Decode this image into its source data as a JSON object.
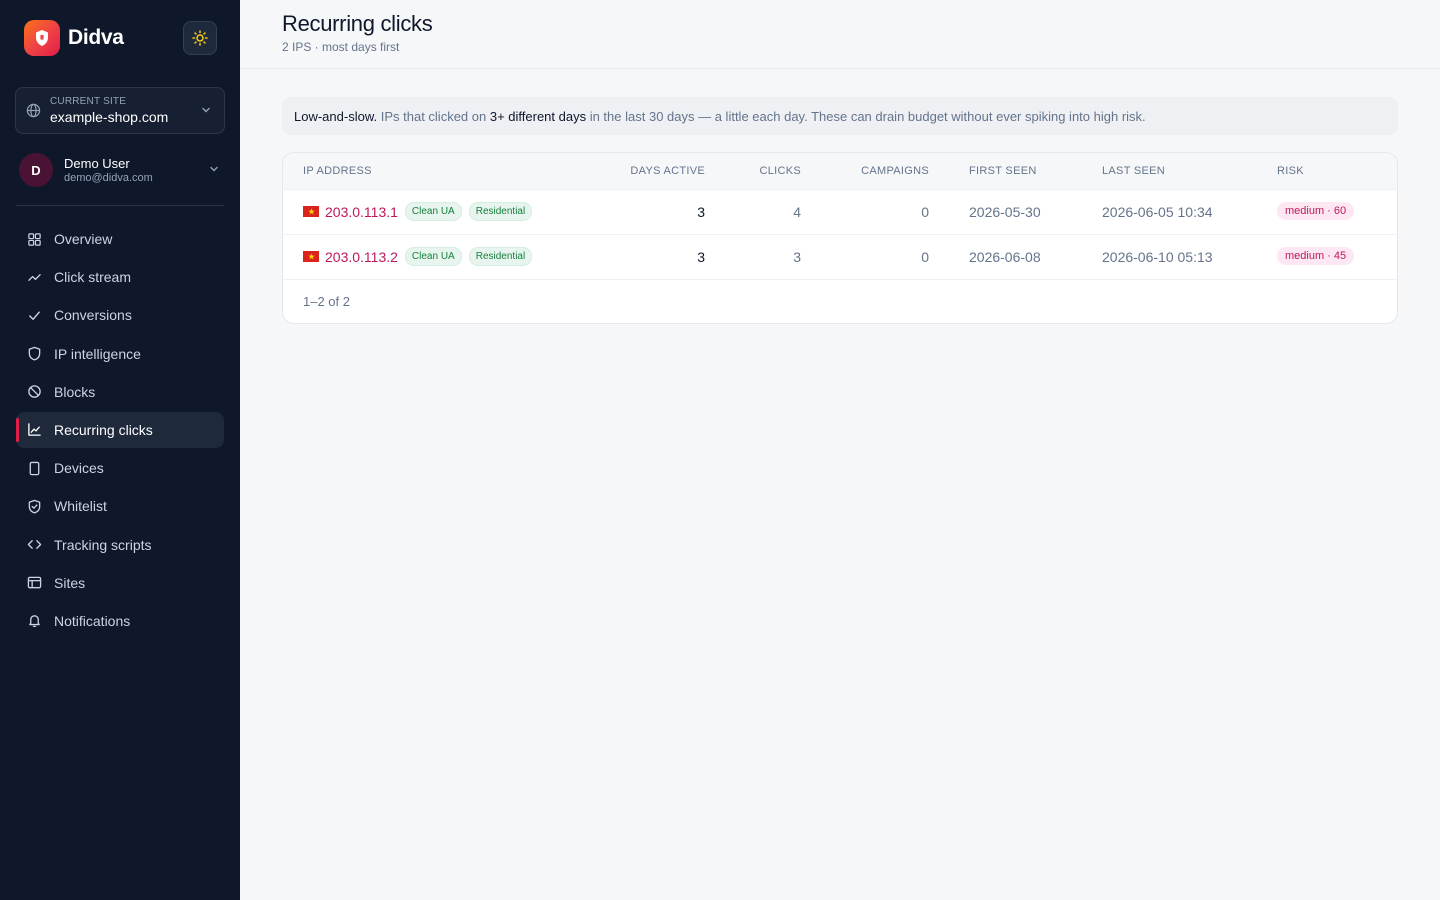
{
  "brand": {
    "name": "Didva"
  },
  "site_selector": {
    "caption": "CURRENT SITE",
    "value": "example-shop.com"
  },
  "user": {
    "initial": "D",
    "name": "Demo User",
    "email": "demo@didva.com"
  },
  "nav": {
    "items": [
      {
        "label": "Overview",
        "icon": "grid-icon"
      },
      {
        "label": "Click stream",
        "icon": "trend-icon"
      },
      {
        "label": "Conversions",
        "icon": "check-icon"
      },
      {
        "label": "IP intelligence",
        "icon": "shield-icon"
      },
      {
        "label": "Blocks",
        "icon": "ban-icon"
      },
      {
        "label": "Recurring clicks",
        "icon": "chart-icon",
        "active": true
      },
      {
        "label": "Devices",
        "icon": "phone-icon"
      },
      {
        "label": "Whitelist",
        "icon": "shield-check-icon"
      },
      {
        "label": "Tracking scripts",
        "icon": "code-icon"
      },
      {
        "label": "Sites",
        "icon": "layout-icon"
      },
      {
        "label": "Notifications",
        "icon": "bell-icon"
      }
    ]
  },
  "header": {
    "title": "Recurring clicks",
    "subtitle": "2 IPS · most days first"
  },
  "info": {
    "lead": "Low-and-slow.",
    "part1": " IPs that clicked on ",
    "emph": "3+ different days",
    "part2": " in the last 30 days — a little each day. These can drain budget without ever spiking into high risk."
  },
  "table": {
    "columns": {
      "ip": "IP ADDRESS",
      "days": "DAYS ACTIVE",
      "clicks": "CLICKS",
      "campaigns": "CAMPAIGNS",
      "first_seen": "FIRST SEEN",
      "last_seen": "LAST SEEN",
      "risk": "RISK"
    },
    "rows": [
      {
        "ip": "203.0.113.1",
        "tag1": "Clean UA",
        "tag2": "Residential",
        "days": "3",
        "clicks": "4",
        "campaigns": "0",
        "first_seen": "2026-05-30",
        "last_seen": "2026-06-05 10:34",
        "risk": "medium · 60"
      },
      {
        "ip": "203.0.113.2",
        "tag1": "Clean UA",
        "tag2": "Residential",
        "days": "3",
        "clicks": "3",
        "campaigns": "0",
        "first_seen": "2026-06-08",
        "last_seen": "2026-06-10 05:13",
        "risk": "medium · 45"
      }
    ],
    "pager": "1–2 of 2"
  },
  "colors": {
    "accent": "#e11d48",
    "sidebar_bg": "#0f172a",
    "ip_link": "#be185d"
  }
}
